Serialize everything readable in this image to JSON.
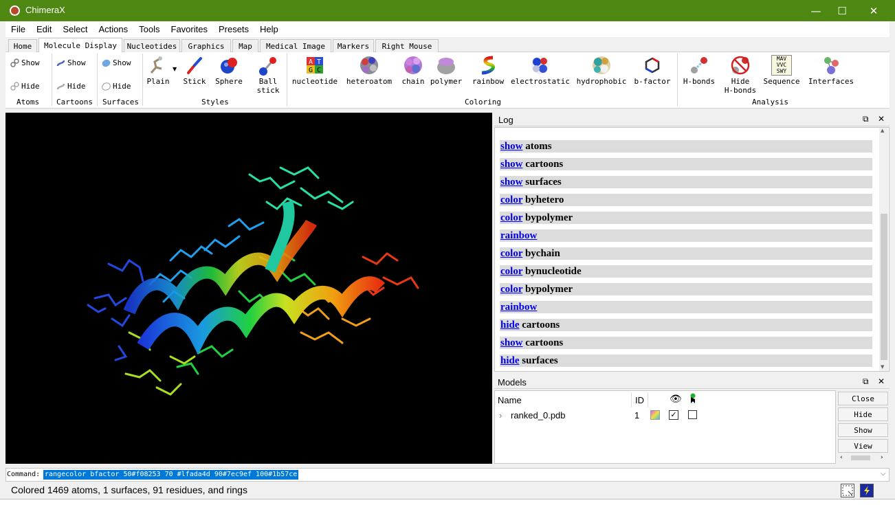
{
  "window": {
    "title": "ChimeraX",
    "minimize": "—",
    "maximize": "☐",
    "close": "✕"
  },
  "menubar": [
    "File",
    "Edit",
    "Select",
    "Actions",
    "Tools",
    "Favorites",
    "Presets",
    "Help"
  ],
  "tabs": [
    "Home",
    "Molecule Display",
    "Nucleotides",
    "Graphics",
    "Map",
    "Medical Image",
    "Markers",
    "Right Mouse"
  ],
  "active_tab": "Molecule Display",
  "toolbar": {
    "atoms": {
      "show": "Show",
      "hide": "Hide",
      "label": "Atoms"
    },
    "cartoons": {
      "show": "Show",
      "hide": "Hide",
      "label": "Cartoons"
    },
    "surfaces": {
      "show": "Show",
      "hide": "Hide",
      "label": "Surfaces"
    },
    "styles": {
      "label": "Styles",
      "items": [
        "Plain",
        "Stick",
        "Sphere",
        "Ball\nstick"
      ]
    },
    "coloring": {
      "label": "Coloring",
      "items": [
        "nucleotide",
        "heteroatom",
        "chain",
        "polymer",
        "rainbow",
        "electrostatic",
        "hydrophobic",
        "b-factor"
      ]
    },
    "analysis": {
      "label": "Analysis",
      "items": [
        "H-bonds",
        "Hide\nH-bonds",
        "Sequence",
        "Interfaces"
      ]
    },
    "sequence_icon_text": [
      "MAV",
      "VVC",
      "SWY"
    ],
    "nucleotide_icon_text": [
      "A",
      "T",
      "G",
      "C"
    ]
  },
  "log": {
    "title": "Log",
    "entries": [
      {
        "cmd": "show",
        "arg": " atoms"
      },
      {
        "cmd": "show",
        "arg": " cartoons"
      },
      {
        "cmd": "show",
        "arg": " surfaces"
      },
      {
        "cmd": "color",
        "arg": " byhetero"
      },
      {
        "cmd": "color",
        "arg": " bypolymer"
      },
      {
        "cmd": "rainbow",
        "arg": ""
      },
      {
        "cmd": "color",
        "arg": " bychain"
      },
      {
        "cmd": "color",
        "arg": " bynucleotide"
      },
      {
        "cmd": "color",
        "arg": " bypolymer"
      },
      {
        "cmd": "rainbow",
        "arg": ""
      },
      {
        "cmd": "hide",
        "arg": " cartoons"
      },
      {
        "cmd": "show",
        "arg": " cartoons"
      },
      {
        "cmd": "hide",
        "arg": " surfaces"
      }
    ]
  },
  "models": {
    "title": "Models",
    "columns": {
      "name": "Name",
      "id": "ID"
    },
    "rows": [
      {
        "name": "ranked_0.pdb",
        "id": "1",
        "shown": true,
        "selected": false
      }
    ],
    "buttons": [
      "Close",
      "Hide",
      "Show",
      "View"
    ]
  },
  "command": {
    "label": "Command:",
    "value": "rangecolor bfactor 50#f08253 70 #lfada4d 90#7ec9ef 100#1b57ce"
  },
  "status": "Colored 1469 atoms, 1 surfaces, 91 residues, and rings",
  "colors": {
    "titlebar": "#4e8712",
    "link": "#0000ee",
    "selection": "#0078d7"
  }
}
